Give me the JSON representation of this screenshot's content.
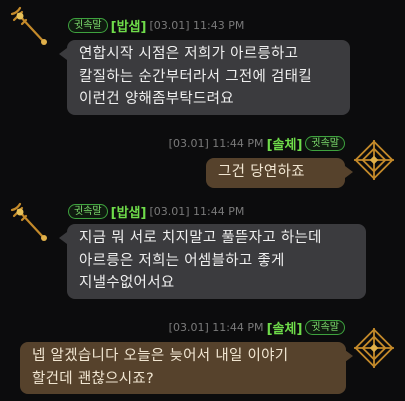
{
  "messages": [
    {
      "sender": "밥샙",
      "badge": "귓속말",
      "time": "[03.01] 11:43 PM",
      "lines": [
        "연합시작 시점은 저희가 아르릉하고",
        "칼질하는 순간부터라서 그전에 검태킬",
        "이런건 양해좀부탁드려요"
      ],
      "avatar_icon": "golden-staff-icon",
      "side": "left"
    },
    {
      "sender": "솔체",
      "badge": "귓속말",
      "time": "[03.01] 11:44 PM",
      "lines": [
        "그건 당연하죠"
      ],
      "avatar_icon": "diamond-emblem-icon",
      "side": "right"
    },
    {
      "sender": "밥샙",
      "badge": "귓속말",
      "time": "[03.01] 11:44 PM",
      "lines": [
        "지금 뭐 서로 치지말고 풀뜯자고 하는데",
        "아르릉은 저희는 어셈블하고 좋게",
        "지낼수없어서요"
      ],
      "avatar_icon": "golden-staff-icon",
      "side": "left"
    },
    {
      "sender": "솔체",
      "badge": "귓속말",
      "time": "[03.01] 11:44 PM",
      "lines": [
        "넵 알겠습니다 오늘은 늦어서 내일 이야기",
        "할건데 괜찮으시죠?"
      ],
      "avatar_icon": "diamond-emblem-icon",
      "side": "right"
    }
  ],
  "colors": {
    "background": "#0c0c0d",
    "incoming_bubble": "#3b3b3e",
    "outgoing_bubble": "#56422c",
    "name": "#6fdc4a",
    "badge_border": "#3ea23e"
  }
}
